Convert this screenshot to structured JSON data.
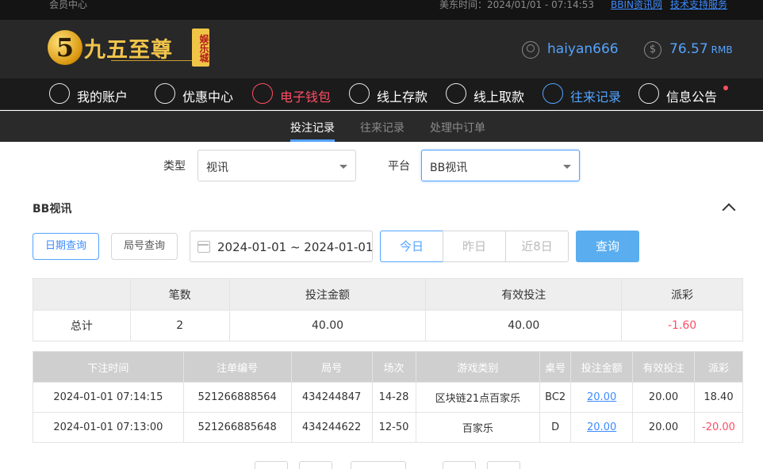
{
  "topbar": {
    "member_center": "会员中心",
    "time_label": "美东时间：2024/01/01 - 07:14:53",
    "link_news": "BBIN资讯网",
    "link_support": "技术支持服务"
  },
  "header": {
    "logo_text": "九五至尊",
    "logo_badge": "娱乐城",
    "username": "haiyan666",
    "balance": "76.57",
    "balance_unit": "RMB"
  },
  "nav": {
    "items": [
      {
        "label": "我的账户",
        "icon": "user-icon"
      },
      {
        "label": "优惠中心",
        "icon": "gift-icon"
      },
      {
        "label": "电子钱包",
        "icon": "wallet-icon"
      },
      {
        "label": "线上存款",
        "icon": "deposit-icon"
      },
      {
        "label": "线上取款",
        "icon": "withdraw-icon"
      },
      {
        "label": "往来记录",
        "icon": "records-icon"
      },
      {
        "label": "信息公告",
        "icon": "bell-icon"
      }
    ]
  },
  "subnav": {
    "tabs": [
      {
        "label": "投注记录"
      },
      {
        "label": "往来记录"
      },
      {
        "label": "处理中订单"
      }
    ]
  },
  "filters": {
    "type_label": "类型",
    "type_value": "视讯",
    "platform_label": "平台",
    "platform_value": "BB视讯"
  },
  "section": {
    "title": "BB视讯"
  },
  "query": {
    "date_query": "日期查询",
    "round_query": "局号查询",
    "date_range": "2024-01-01 ~ 2024-01-01",
    "today": "今日",
    "yesterday": "昨日",
    "last8": "近8日",
    "search": "查询"
  },
  "summary": {
    "headers": [
      "",
      "笔数",
      "投注金额",
      "有效投注",
      "派彩"
    ],
    "row": [
      "总计",
      "2",
      "40.00",
      "40.00",
      "-1.60"
    ]
  },
  "details": {
    "headers": [
      "下注时间",
      "注单编号",
      "局号",
      "场次",
      "游戏类别",
      "桌号",
      "投注金额",
      "有效投注",
      "派彩"
    ],
    "rows": [
      [
        "2024-01-01 07:14:15",
        "521266888564",
        "434244847",
        "14-28",
        "区块链21点百家乐",
        "BC2",
        "20.00",
        "20.00",
        "18.40"
      ],
      [
        "2024-01-01 07:13:00",
        "521266885648",
        "434244622",
        "12-50",
        "百家乐",
        "D",
        "20.00",
        "20.00",
        "-20.00"
      ]
    ]
  }
}
